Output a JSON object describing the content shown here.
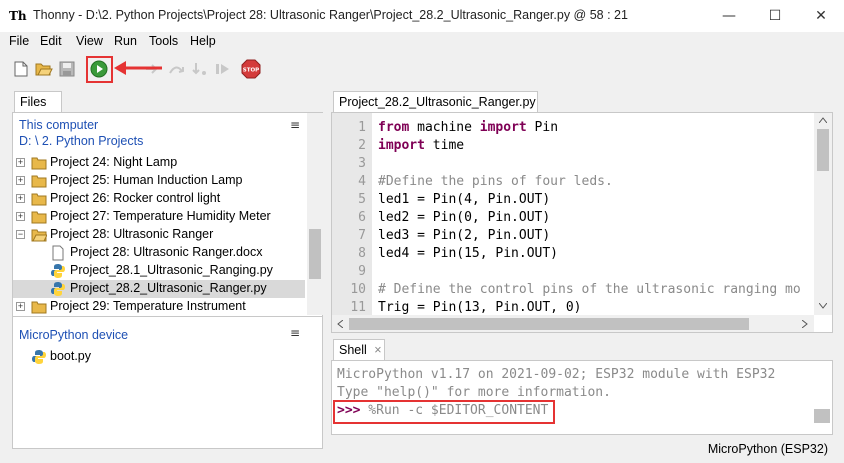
{
  "window": {
    "app_name": "Thonny",
    "title": "Thonny  -  D:\\2. Python Projects\\Project 28:  Ultrasonic Ranger\\Project_28.2_Ultrasonic_Ranger.py  @  58 : 21",
    "controls": [
      "—",
      "☐",
      "✕"
    ]
  },
  "menu": [
    "File",
    "Edit",
    "View",
    "Run",
    "Tools",
    "Help"
  ],
  "toolbar": {
    "icons": [
      "new-file-icon",
      "open-file-icon",
      "save-icon",
      "run-icon",
      "debug-icon",
      "step-over-icon",
      "step-into-icon",
      "step-out-icon",
      "resume-icon",
      "stop-icon"
    ],
    "stop_label": "STOP",
    "accent_run": "#3a9a3a",
    "accent_stop": "#d43b3b",
    "annotation_color": "#e53333"
  },
  "files": {
    "tab_label": "Files",
    "tab_close": "×",
    "computer": {
      "title": "This computer",
      "path": "D: \\ 2. Python Projects",
      "menu_glyph": "≡",
      "items": [
        {
          "label": "Project 24:  Night Lamp",
          "type": "folder",
          "expander": "+"
        },
        {
          "label": "Project 25:  Human  Induction Lamp",
          "type": "folder",
          "expander": "+"
        },
        {
          "label": "Project 26:  Rocker control light",
          "type": "folder",
          "expander": "+"
        },
        {
          "label": "Project 27:  Temperature Humidity Meter",
          "type": "folder",
          "expander": "+"
        },
        {
          "label": "Project 28:  Ultrasonic Ranger",
          "type": "folder",
          "expander": "−"
        },
        {
          "label": "Project 28:  Ultrasonic Ranger.docx",
          "type": "doc"
        },
        {
          "label": "Project_28.1_Ultrasonic_Ranging.py",
          "type": "python"
        },
        {
          "label": "Project_28.2_Ultrasonic_Ranger.py",
          "type": "python",
          "selected": true
        },
        {
          "label": "Project 29:  Temperature Instrument",
          "type": "folder",
          "expander": "+"
        }
      ]
    },
    "device": {
      "title": "MicroPython device",
      "menu_glyph": "≡",
      "items": [
        {
          "label": "boot.py",
          "type": "python"
        }
      ]
    }
  },
  "editor": {
    "tab_label": "Project_28.2_Ultrasonic_Ranger.py",
    "tab_close": "×",
    "line_numbers": [
      "1",
      "2",
      "3",
      "4",
      "5",
      "6",
      "7",
      "8",
      "9",
      "10",
      "11"
    ],
    "lines": [
      {
        "kw": "from",
        "rest": " machine ",
        "kw2": "import",
        "rest2": " Pin"
      },
      {
        "kw": "import",
        "rest": " time"
      },
      {
        "text": ""
      },
      {
        "comment": "#Define the pins of four leds."
      },
      {
        "text": "led1 = Pin(4, Pin.OUT)"
      },
      {
        "text": "led2 = Pin(0, Pin.OUT)"
      },
      {
        "text": "led3 = Pin(2, Pin.OUT)"
      },
      {
        "text": "led4 = Pin(15, Pin.OUT)"
      },
      {
        "text": ""
      },
      {
        "comment": "# Define the control pins of the ultrasonic ranging mo"
      },
      {
        "text": "Trig = Pin(13, Pin.OUT, 0)"
      }
    ]
  },
  "shell": {
    "tab_label": "Shell",
    "tab_close": "×",
    "line1": "MicroPython v1.17 on 2021-09-02; ESP32 module with ESP32",
    "line2": "Type \"help()\" for more information.",
    "prompt": ">>>",
    "command": " %Run -c $EDITOR_CONTENT"
  },
  "status": {
    "interpreter": "MicroPython (ESP32)"
  }
}
